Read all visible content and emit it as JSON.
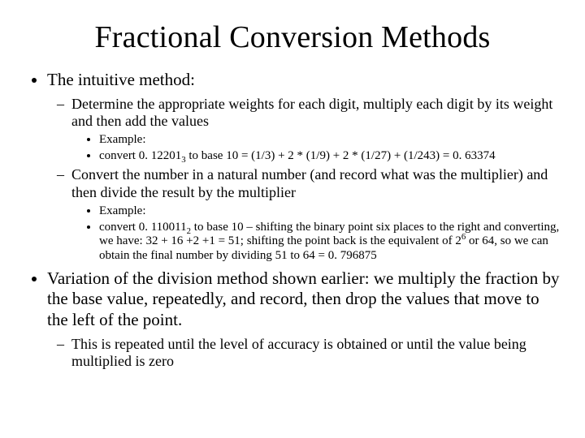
{
  "title": "Fractional Conversion Methods",
  "b1": {
    "text": "The intuitive method:",
    "s1": {
      "text": "Determine the appropriate weights for each digit, multiply each digit by its weight and then add the values",
      "ex_label": "Example:",
      "ex_pre": "convert 0. 12201",
      "ex_sub": "3",
      "ex_post": " to base 10 = (1/3) + 2 * (1/9) + 2 * (1/27) +  (1/243) = 0. 63374"
    },
    "s2": {
      "text": "Convert the number in a natural number (and record what was the multiplier) and then divide the result by the multiplier",
      "ex_label": "Example:",
      "ex_pre": "convert 0. 110011",
      "ex_sub": "2",
      "ex_mid1": " to base 10 – shifting the binary point six places to the right and converting, we have: 32 + 16 +2 +1 = 51; shifting the point back is the equivalent of 2",
      "ex_sup": "6",
      "ex_mid2": " or 64, so we can obtain the final number by dividing 51 to 64 = 0. 796875"
    }
  },
  "b2": {
    "text": "Variation of the division method shown earlier: we multiply the fraction by the base value, repeatedly, and record, then drop the values that move to the left of the point.",
    "s1": {
      "text": "This is repeated until the level of accuracy is obtained or until the value being multiplied is zero"
    }
  }
}
